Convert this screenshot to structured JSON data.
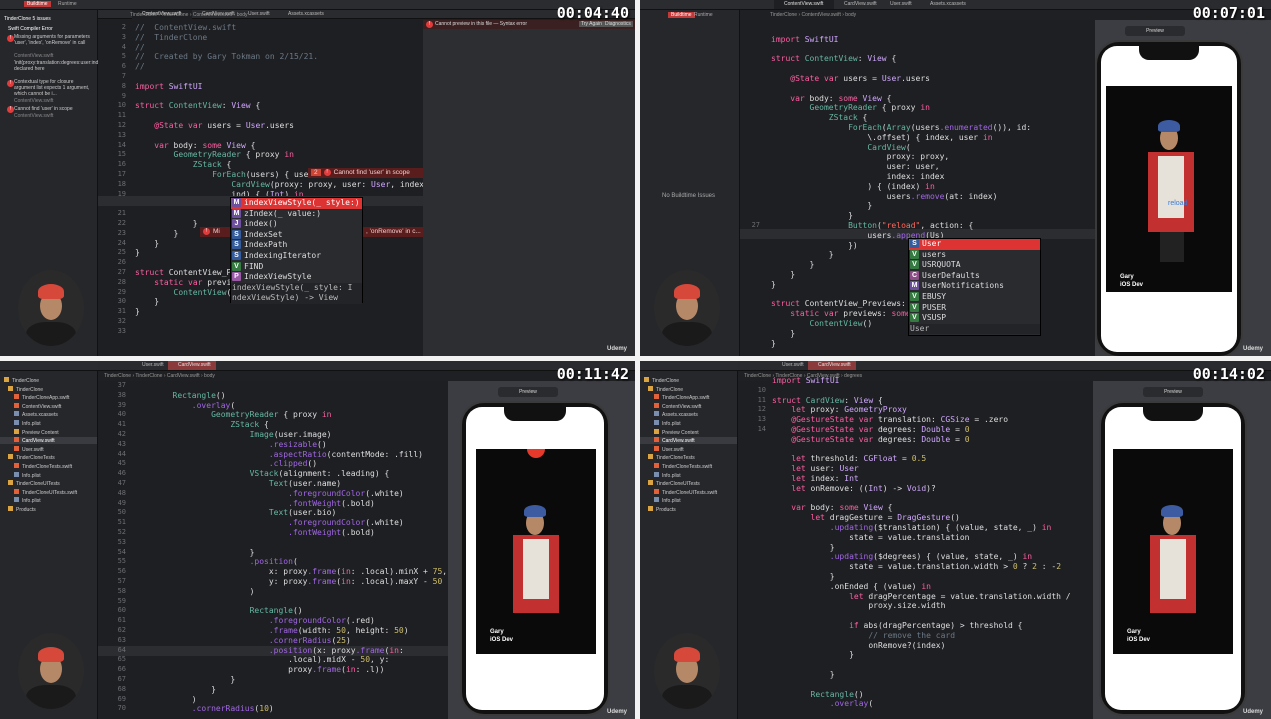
{
  "p1": {
    "timestamp": "00:04:40",
    "scheme": "Buildtime",
    "scheme2": "Runtime",
    "tabs": [
      "ContentView.swift",
      "CardView.swift",
      "User.swift",
      "Assets.xcassets"
    ],
    "crumb": "TinderClone › TinderClone › ContentView.swift › body",
    "preview_error": "Cannot preview in this file — Syntax error",
    "try_again": "Try Again",
    "diagnostics": "Diagnostics",
    "issues": [
      "TinderClone 5 issues",
      "Swift Compiler Error",
      "Missing arguments for parameters 'user', 'index', 'onRemove' in call",
      "ContentView.swift",
      "'init(proxy:translation:degrees:user:index:onRemove:)' declared here",
      "Contextual type for closure argument list expects 1 argument, which cannot be i...",
      "ContentView.swift",
      "Cannot find 'user' in scope",
      "ContentView.swift"
    ],
    "gutter": [
      "2",
      "3",
      "4",
      "5",
      "6",
      "7",
      "8",
      "9",
      "10",
      "11",
      "12",
      "13",
      "14",
      "15",
      "16",
      "17",
      "18",
      "19",
      "20",
      "21",
      "22",
      "23",
      "24",
      "25",
      "26",
      "27",
      "28",
      "29",
      "30",
      "31",
      "32",
      "33"
    ],
    "code": [
      "//  ContentView.swift",
      "//  TinderClone",
      "//",
      "//  Created by Gary Tokman on 2/15/21.",
      "//",
      "",
      "import SwiftUI",
      "",
      "struct ContentView: View {",
      "",
      "    @State var users = User.users",
      "",
      "    var body: some View {",
      "        GeometryReader { proxy in",
      "            ZStack {",
      "                ForEach(users) { user",
      "                    CardView(proxy: proxy, user: User, index:",
      "                    ind) { (Int) in",
      "",
      "",
      "            }",
      "        }",
      "    }",
      "}",
      "",
      "struct ContentView_Previews: PreviewProvider {",
      "    static var previews: some View {",
      "        ContentView()",
      "    }",
      "}",
      "",
      ""
    ],
    "error1_count": "2",
    "error1": "Cannot find 'user' in scope",
    "error2": "Mi",
    "error2b": ", 'onRemove' in c...",
    "autocomplete": [
      {
        "b": "M",
        "t": "indexViewStyle(_ style:)"
      },
      {
        "b": "M",
        "t": "zIndex(_ value:)"
      },
      {
        "b": "J",
        "t": "index()"
      },
      {
        "b": "S",
        "t": "IndexSet"
      },
      {
        "b": "S",
        "t": "IndexPath"
      },
      {
        "b": "S",
        "t": "IndexingIterator"
      },
      {
        "b": "V",
        "t": "FIND"
      },
      {
        "b": "P",
        "t": "IndexViewStyle"
      }
    ],
    "autocomplete_doc1": "indexViewStyle(_ style: I",
    "autocomplete_doc2": "ndexViewStyle) -> View"
  },
  "p2": {
    "timestamp": "00:07:01",
    "scheme": "Buildtime",
    "scheme2": "Runtime",
    "tabs": [
      "ContentView.swift",
      "CardView.swift",
      "User.swift",
      "Assets.xcassets"
    ],
    "crumb": "TinderClone › ContentView.swift › body",
    "no_issues": "No Buildtime Issues",
    "preview_label": "Preview",
    "gutter": [
      "",
      "",
      "",
      "",
      "",
      "",
      "",
      "",
      "",
      "",
      "",
      "",
      "",
      "",
      "",
      "",
      "",
      "",
      "",
      "",
      "27",
      "",
      "",
      "",
      "",
      "",
      "",
      "",
      "",
      "",
      "",
      ""
    ],
    "code": [
      "",
      "import SwiftUI",
      "",
      "struct ContentView: View {",
      "",
      "    @State var users = User.users",
      "",
      "    var body: some View {",
      "        GeometryReader { proxy in",
      "            ZStack {",
      "                ForEach(Array(users.enumerated()), id:",
      "                    \\.offset) { index, user in",
      "                    CardView(",
      "                        proxy: proxy,",
      "                        user: user,",
      "                        index: index",
      "                    ) { (index) in",
      "                        users.remove(at: index)",
      "                    }",
      "                }",
      "                Button(\"reload\", action: {",
      "                    users.append(Us)",
      "                })",
      "            }",
      "        }",
      "    }",
      "}",
      "",
      "struct ContentView_Previews: P",
      "    static var previews: some",
      "        ContentView()",
      "    }",
      "}"
    ],
    "autocomplete": [
      {
        "b": "S",
        "t": "User"
      },
      {
        "b": "V",
        "t": "users"
      },
      {
        "b": "V",
        "t": "USRQUOTA"
      },
      {
        "b": "C",
        "t": "UserDefaults"
      },
      {
        "b": "M",
        "t": "UserNotifications"
      },
      {
        "b": "V",
        "t": "EBUSY"
      },
      {
        "b": "V",
        "t": "PUSER"
      },
      {
        "b": "V",
        "t": "VSUSP"
      }
    ],
    "autocomplete_doc": "User",
    "reload_label": "reload",
    "card_name": "Gary",
    "card_bio": "iOS Dev"
  },
  "p3": {
    "timestamp": "00:11:42",
    "tabs": [
      "User.swift",
      "CardView.swift"
    ],
    "crumb": "TinderClone › TinderClone › CardView.swift › body",
    "preview_label": "Preview",
    "nav": [
      "TinderClone",
      "TinderClone",
      "TinderCloneApp.swift",
      "ContentView.swift",
      "Assets.xcassets",
      "Info.plist",
      "Preview Content",
      "CardView.swift",
      "User.swift",
      "TinderCloneTests",
      "TinderCloneTests.swift",
      "Info.plist",
      "TinderCloneUITests",
      "TinderCloneUITests.swift",
      "Info.plist",
      "Products"
    ],
    "gutter": [
      "37",
      "38",
      "39",
      "40",
      "41",
      "42",
      "43",
      "44",
      "45",
      "46",
      "47",
      "48",
      "49",
      "50",
      "51",
      "52",
      "53",
      "54",
      "55",
      "56",
      "57",
      "58",
      "59",
      "60",
      "61",
      "62",
      "63",
      "64",
      "65",
      "66",
      "67",
      "68",
      "69",
      "70"
    ],
    "code": [
      "",
      "        Rectangle()",
      "            .overlay(",
      "                GeometryReader { proxy in",
      "                    ZStack {",
      "                        Image(user.image)",
      "                            .resizable()",
      "                            .aspectRatio(contentMode: .fill)",
      "                            .clipped()",
      "                        VStack(alignment: .leading) {",
      "                            Text(user.name)",
      "                                .foregroundColor(.white)",
      "                                .fontWeight(.bold)",
      "                            Text(user.bio)",
      "                                .foregroundColor(.white)",
      "                                .fontWeight(.bold)",
      "",
      "                        }",
      "                        .position(",
      "                            x: proxy.frame(in: .local).minX + 75,",
      "                            y: proxy.frame(in: .local).maxY - 50",
      "                        )",
      "",
      "                        Rectangle()",
      "                            .foregroundColor(.red)",
      "                            .frame(width: 50, height: 50)",
      "                            .cornerRadius(25)",
      "                            .position(x: proxy.frame(in:",
      "                                .local).midX - 50, y:",
      "                                proxy.frame(in: .l))",
      "                    }",
      "                }",
      "            )",
      "            .cornerRadius(10)"
    ],
    "current_line": "64",
    "card_name": "Gary",
    "card_bio": "iOS Dev"
  },
  "p4": {
    "timestamp": "00:14:02",
    "tabs": [
      "User.swift",
      "CardView.swift"
    ],
    "crumb": "TinderClone › TinderClone › CardView.swift › degrees",
    "preview_label": "Preview",
    "nav": [
      "TinderClone",
      "TinderClone",
      "TinderCloneApp.swift",
      "ContentView.swift",
      "Assets.xcassets",
      "Info.plist",
      "Preview Content",
      "CardView.swift",
      "User.swift",
      "TinderCloneTests",
      "TinderCloneTests.swift",
      "Info.plist",
      "TinderCloneUITests",
      "TinderCloneUITests.swift",
      "Info.plist",
      "Products"
    ],
    "gutter": [
      "",
      "10",
      "11",
      "12",
      "13",
      "14",
      "",
      "",
      "",
      "",
      "",
      "",
      "",
      "",
      "",
      "",
      "",
      "",
      "",
      "",
      "",
      "",
      "",
      "",
      "",
      "",
      "",
      "",
      "",
      "",
      "",
      "",
      "",
      ""
    ],
    "code": [
      "import SwiftUI",
      "",
      "struct CardView: View {",
      "    let proxy: GeometryProxy",
      "    @GestureState var translation: CGSize = .zero",
      "    @GestureState var degrees: Double = 0",
      "    @GestureState var degrees: Double = 0",
      "",
      "    let threshold: CGFloat = 0.5",
      "    let user: User",
      "    let index: Int",
      "    let onRemove: ((Int) -> Void)?",
      "",
      "    var body: some View {",
      "        let dragGesture = DragGesture()",
      "            .updating($translation) { (value, state, _) in",
      "                state = value.translation",
      "            }",
      "            .updating($degrees) { (value, state, _) in",
      "                state = value.translation.width > 0 ? 2 : -2",
      "            }",
      "            .onEnded { (value) in",
      "                let dragPercentage = value.translation.width /",
      "                    proxy.size.width",
      "",
      "                if abs(dragPercentage) > threshold {",
      "                    // remove the card",
      "                    onRemove?(index)",
      "                }",
      "",
      "            }",
      "",
      "        Rectangle()",
      "            .overlay("
    ],
    "card_name": "Gary",
    "card_bio": "iOS Dev"
  },
  "watermark": "Udemy",
  "colors": {
    "editor_bg": "#1e1f22",
    "keyword": "#fc5fa3",
    "type": "#d0a8ff",
    "comment": "#6c7986",
    "error": "#e23b3b"
  }
}
